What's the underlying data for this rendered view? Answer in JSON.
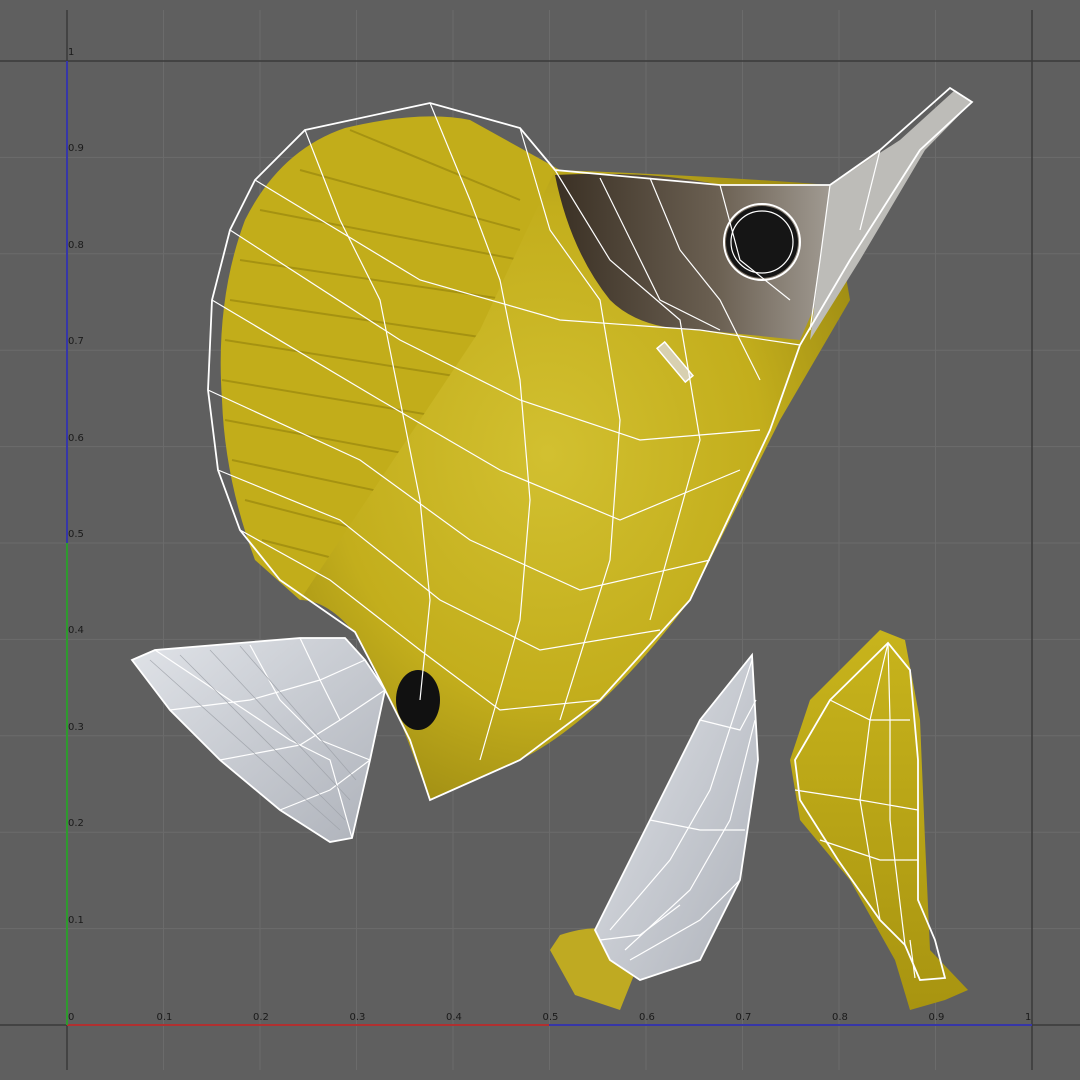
{
  "uv_editor": {
    "x_ticks": [
      "0.1",
      "0.2",
      "0.3",
      "0.4",
      "0.5",
      "0.6",
      "0.7",
      "0.8",
      "0.9",
      "1"
    ],
    "y_ticks": [
      "0.1",
      "0.2",
      "0.3",
      "0.4",
      "0.5",
      "0.6",
      "0.7",
      "0.8",
      "0.9",
      "1"
    ],
    "origin_label": "0",
    "colors": {
      "background": "#5f5f5f",
      "grid": "#6b6b6b",
      "frame": "#3c3c3c",
      "u_axis_low": "#b03030",
      "u_axis_high": "#3636a8",
      "v_axis_low": "#2e9a2e",
      "v_axis_high": "#3636a8",
      "wire": "#ffffff",
      "fish_yellow": "#c8b21e",
      "fish_dark": "#3e3428",
      "fin_pale": "#c9cbd0"
    },
    "islands": [
      "fish-body-island",
      "tail-fin-island",
      "pectoral-fin-island",
      "ventral-fin-island"
    ]
  }
}
